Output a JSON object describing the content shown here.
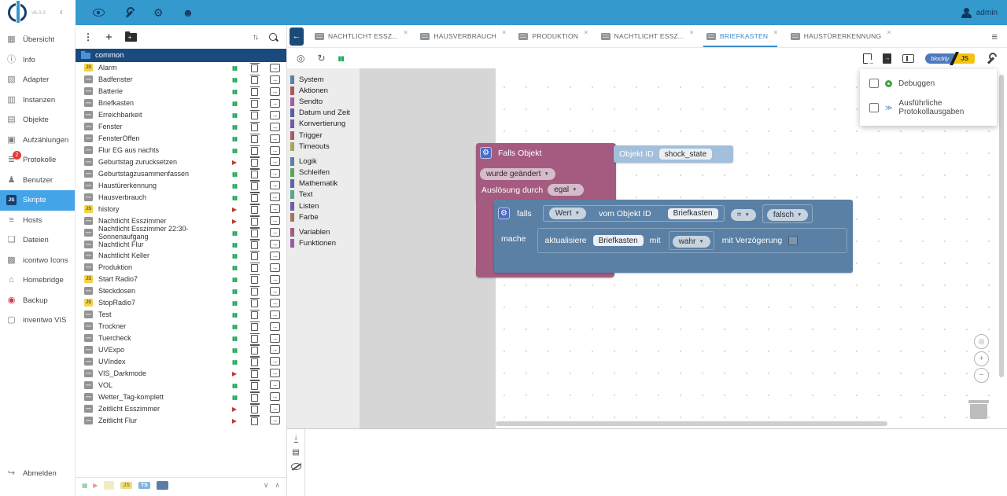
{
  "app": {
    "version": "v6.3.3",
    "user": "admin"
  },
  "header": {
    "icons": [
      "eye-icon",
      "wrench-icon",
      "gear-icon",
      "expert-mode-icon"
    ]
  },
  "sidebar": {
    "items": [
      {
        "label": "Übersicht",
        "icon": "grid-icon",
        "glyph": "▦"
      },
      {
        "label": "Info",
        "icon": "info-icon",
        "glyph": "ⓘ"
      },
      {
        "label": "Adapter",
        "icon": "adapter-icon",
        "glyph": "▧"
      },
      {
        "label": "Instanzen",
        "icon": "instances-icon",
        "glyph": "▥"
      },
      {
        "label": "Objekte",
        "icon": "objects-icon",
        "glyph": "▤"
      },
      {
        "label": "Aufzählungen",
        "icon": "enums-icon",
        "glyph": "▣"
      },
      {
        "label": "Protokolle",
        "icon": "logs-icon",
        "glyph": "≣",
        "badge": "2"
      },
      {
        "label": "Benutzer",
        "icon": "users-icon",
        "glyph": "♟"
      },
      {
        "label": "Skripte",
        "icon": "js-icon",
        "glyph": "JS",
        "state": "selected"
      },
      {
        "label": "Hosts",
        "icon": "hosts-icon",
        "glyph": "≡"
      },
      {
        "label": "Dateien",
        "icon": "files-icon",
        "glyph": "❏"
      },
      {
        "label": "icontwo Icons",
        "icon": "icons-icon",
        "glyph": "▩"
      },
      {
        "label": "Homebridge",
        "icon": "homebridge-icon",
        "glyph": "⌂"
      },
      {
        "label": "Backup",
        "icon": "backup-icon",
        "glyph": "◉"
      },
      {
        "label": "inventwo VIS",
        "icon": "vis-icon",
        "glyph": "▢"
      }
    ],
    "logout": {
      "label": "Abmelden",
      "icon": "logout-icon",
      "glyph": "↪"
    }
  },
  "scripts_panel": {
    "folder": {
      "name": "common"
    },
    "filter_badges": {
      "js": "JS",
      "ts": "TS"
    },
    "items": [
      {
        "name": "Alarm",
        "type": "js",
        "status": "running"
      },
      {
        "name": "Badfenster",
        "type": "blockly",
        "status": "running"
      },
      {
        "name": "Batterie",
        "type": "blockly",
        "status": "running"
      },
      {
        "name": "Briefkasten",
        "type": "blockly",
        "status": "running"
      },
      {
        "name": "Erreichbarkeit",
        "type": "blockly",
        "status": "running"
      },
      {
        "name": "Fenster",
        "type": "blockly",
        "status": "running"
      },
      {
        "name": "FensterOffen",
        "type": "blockly",
        "status": "running"
      },
      {
        "name": "Flur EG aus nachts",
        "type": "blockly",
        "status": "running"
      },
      {
        "name": "Geburtstag zurucksetzen",
        "type": "blockly",
        "status": "stopped"
      },
      {
        "name": "Geburtstagzusammenfassen",
        "type": "blockly",
        "status": "running"
      },
      {
        "name": "Haustürerkennung",
        "type": "blockly",
        "status": "running"
      },
      {
        "name": "Hausverbrauch",
        "type": "blockly",
        "status": "running"
      },
      {
        "name": "history",
        "type": "js",
        "status": "stopped"
      },
      {
        "name": "Nachtlicht Esszimmer",
        "type": "blockly",
        "status": "stopped"
      },
      {
        "name": "Nachtlicht Esszimmer 22:30-Sonnenaufgang",
        "type": "blockly",
        "status": "running"
      },
      {
        "name": "Nachtlicht Flur",
        "type": "blockly",
        "status": "running"
      },
      {
        "name": "Nachtlicht Keller",
        "type": "blockly",
        "status": "running"
      },
      {
        "name": "Produktion",
        "type": "blockly",
        "status": "running"
      },
      {
        "name": "Start Radio7",
        "type": "js",
        "status": "running"
      },
      {
        "name": "Steckdosen",
        "type": "blockly",
        "status": "running"
      },
      {
        "name": "StopRadio7",
        "type": "js",
        "status": "running"
      },
      {
        "name": "Test",
        "type": "blockly",
        "status": "running"
      },
      {
        "name": "Trockner",
        "type": "blockly",
        "status": "running"
      },
      {
        "name": "Tuercheck",
        "type": "blockly",
        "status": "running"
      },
      {
        "name": "UVExpo",
        "type": "blockly",
        "status": "running"
      },
      {
        "name": "UVIndex",
        "type": "blockly",
        "status": "running"
      },
      {
        "name": "VIS_Darkmode",
        "type": "blockly",
        "status": "stopped"
      },
      {
        "name": "VOL",
        "type": "blockly",
        "status": "running"
      },
      {
        "name": "Wetter_Tag-komplett",
        "type": "blockly",
        "status": "running"
      },
      {
        "name": "Zeitlicht Esszimmer",
        "type": "blockly",
        "status": "stopped"
      },
      {
        "name": "Zeitlicht Flur",
        "type": "blockly",
        "status": "stopped"
      }
    ]
  },
  "tabs": {
    "items": [
      {
        "label": "NACHTLICHT ESSZ...",
        "close": "×"
      },
      {
        "label": "HAUSVERBRAUCH",
        "close": "×"
      },
      {
        "label": "PRODUKTION",
        "close": "×"
      },
      {
        "label": "NACHTLICHT ESSZ...",
        "close": "×"
      },
      {
        "label": "BRIEFKASTEN",
        "close": "×",
        "state": "active"
      },
      {
        "label": "HAUSTÜRERKENNUNG",
        "close": "×"
      }
    ]
  },
  "editor": {
    "toggle": {
      "blockly": "blockly",
      "js": "JS"
    },
    "settings_menu": {
      "items": [
        {
          "label": "Debuggen",
          "icon": "debug-icon"
        },
        {
          "label": "Ausführliche Protokollausgaben",
          "icon": "verbose-log-icon"
        }
      ]
    }
  },
  "blockly": {
    "categories": [
      {
        "label": "System",
        "color": "#5b80a5"
      },
      {
        "label": "Aktionen",
        "color": "#a55b5b"
      },
      {
        "label": "Sendto",
        "color": "#a55ba5"
      },
      {
        "label": "Datum und Zeit",
        "color": "#5b5ba5"
      },
      {
        "label": "Konvertierung",
        "color": "#745ba5"
      },
      {
        "label": "Trigger",
        "color": "#a55b6a"
      },
      {
        "label": "Timeouts",
        "color": "#a5a55b"
      },
      {
        "label": "Logik",
        "color": "#5b80a5",
        "spacer": "spacer"
      },
      {
        "label": "Schleifen",
        "color": "#5ba55b"
      },
      {
        "label": "Mathematik",
        "color": "#5b67a5"
      },
      {
        "label": "Text",
        "color": "#5ba58c"
      },
      {
        "label": "Listen",
        "color": "#745ba5"
      },
      {
        "label": "Farbe",
        "color": "#a5745b"
      },
      {
        "label": "Variablen",
        "color": "#a55b80",
        "spacer": "spacer"
      },
      {
        "label": "Funktionen",
        "color": "#995ba5"
      }
    ],
    "blocks": {
      "trigger": {
        "title": "Falls Objekt",
        "changed": "wurde geändert",
        "trigger_by": "Auslösung durch",
        "trigger_value": "egal"
      },
      "oid": {
        "label": "Objekt ID",
        "value": "shock_state"
      },
      "if": {
        "if_label": "falls",
        "do_label": "mache",
        "value_dd": "Wert",
        "from_label": "vom Objekt ID",
        "oid": "Briefkasten",
        "op": "=",
        "rhs": "falsch"
      },
      "update": {
        "label": "aktualisiere",
        "oid": "Briefkasten",
        "with_label": "mit",
        "value": "wahr",
        "delay_label": "mit Verzögerung"
      }
    }
  }
}
